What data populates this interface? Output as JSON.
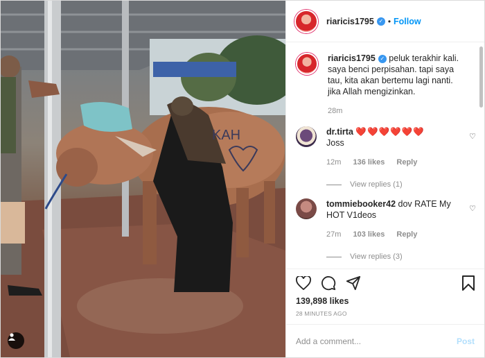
{
  "post": {
    "username": "riaricis1795",
    "follow_label": "Follow",
    "dot": "•",
    "verified_mark": "✓"
  },
  "caption": {
    "username": "riaricis1795",
    "text": "peluk terakhir kali. saya benci perpisahan. tapi saya tau, kita akan bertemu lagi nanti. jika Allah mengizinkan.",
    "time": "28m"
  },
  "comments": [
    {
      "username": "dr.tirta",
      "text_emojis": "❤️❤️❤️❤️❤️❤️",
      "text": "Joss",
      "time": "12m",
      "likes": "136 likes",
      "reply": "Reply",
      "view_replies": "View replies (1)"
    },
    {
      "username": "tommiebooker42",
      "text": "dov RATE My HOT V1deos",
      "time": "27m",
      "likes": "103 likes",
      "reply": "Reply",
      "view_replies": "View replies (3)"
    }
  ],
  "stats": {
    "likes": "139,898 likes",
    "ago": "28 MINUTES AGO"
  },
  "add_comment": {
    "placeholder": "Add a comment...",
    "post_label": "Post"
  },
  "photo_text": "KAH",
  "icons": [
    "heart-icon",
    "comment-icon",
    "share-icon",
    "bookmark-icon",
    "user-tag-icon"
  ]
}
